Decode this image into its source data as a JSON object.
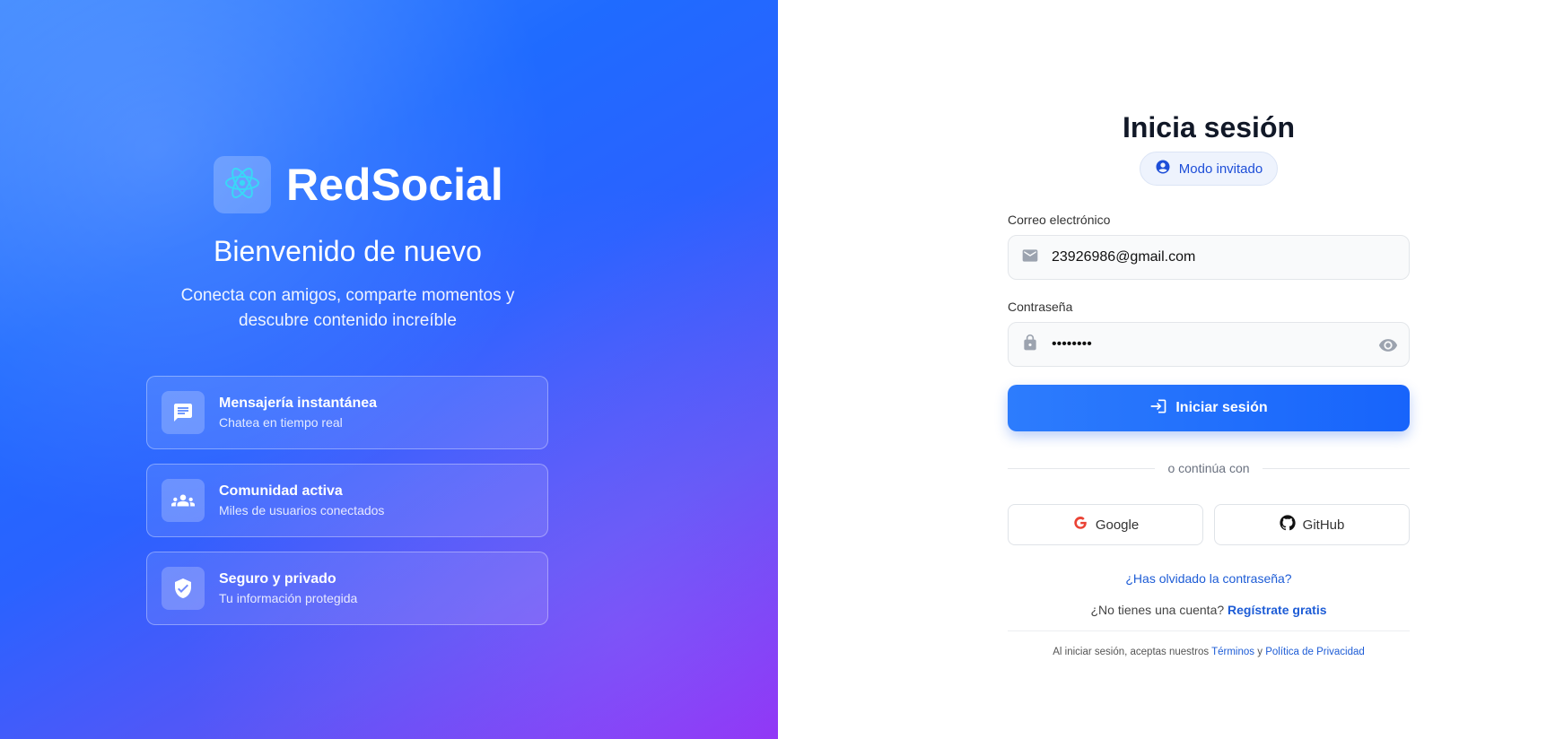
{
  "brand": {
    "name": "RedSocial",
    "welcome": "Bienvenido de nuevo",
    "tagline": "Conecta con amigos, comparte momentos y descubre contenido increíble",
    "logo_icon": "react-atom-icon"
  },
  "features": [
    {
      "title": "Mensajería instantánea",
      "subtitle": "Chatea en tiempo real",
      "icon": "chat-icon"
    },
    {
      "title": "Comunidad activa",
      "subtitle": "Miles de usuarios conectados",
      "icon": "group-icon"
    },
    {
      "title": "Seguro y privado",
      "subtitle": "Tu información protegida",
      "icon": "shield-check-icon"
    }
  ],
  "login": {
    "title": "Inicia sesión",
    "guest_label": "Modo invitado",
    "email_label": "Correo electrónico",
    "email_value": "23926986@gmail.com",
    "password_label": "Contraseña",
    "password_value": "••••••••",
    "submit_label": "Iniciar sesión",
    "divider_text": "o continúa con",
    "google_label": "Google",
    "github_label": "GitHub",
    "forgot_label": "¿Has olvidado la contraseña?",
    "signup_prompt": "¿No tienes una cuenta?",
    "signup_link": "Regístrate gratis",
    "terms_prefix": "Al iniciar sesión, aceptas nuestros",
    "terms_link": "Términos",
    "terms_and": "y",
    "privacy_link": "Política de Privacidad"
  },
  "colors": {
    "accent": "#1d5cd6",
    "button": "#2370fc",
    "gradient_start": "#3a86ff",
    "gradient_end": "#8c2cf5"
  }
}
